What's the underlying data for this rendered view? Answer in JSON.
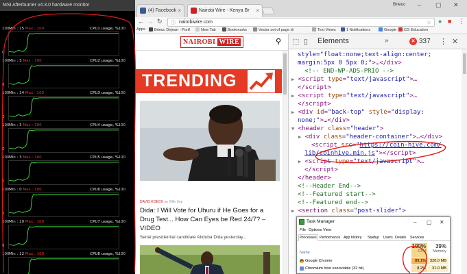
{
  "afterburner": {
    "title": "MSI Afterburner v4.3.0 hardware monitor",
    "top_scale": "100",
    "rows": [
      {
        "min": "15",
        "max": "100",
        "label": "CPU1 usage, %",
        "bottom": "0"
      },
      {
        "min": "3",
        "max": "100",
        "label": "CPU2 usage, %",
        "bottom": "0"
      },
      {
        "min": "14",
        "max": "100",
        "label": "CPU3 usage, %",
        "bottom": "0"
      },
      {
        "min": "3",
        "max": "100",
        "label": "CPU4 usage, %",
        "bottom": "0"
      },
      {
        "min": "3",
        "max": "100",
        "label": "CPU5 usage, %",
        "bottom": "0"
      },
      {
        "min": "0",
        "max": "100",
        "label": "CPU6 usage, %",
        "bottom": "0"
      },
      {
        "min": "10",
        "max": "100",
        "label": "CPU7 usage, %",
        "bottom": "0"
      },
      {
        "min": "12",
        "max": "100",
        "label": "CPU8 usage, %",
        "bottom": "0"
      }
    ],
    "min_label": "Min :",
    "max_label": "Max :"
  },
  "chrome": {
    "tabs": [
      {
        "title": "(4) Facebook"
      },
      {
        "title": "Nairobi Wire - Kenya Br"
      }
    ],
    "user": "Brieuc",
    "address": "nairobiwire.com",
    "bookmarks": [
      "Apps",
      "Brieuc Dejean - Portf",
      "New Tab",
      "Bookmarks",
      "Vector set of page di",
      "Text Views",
      "1 Notifications",
      "Google",
      "CG Education"
    ]
  },
  "site": {
    "logo_left": "NAIROBI",
    "logo_right": "WIRE",
    "trending": "TRENDING",
    "article1": {
      "author": "DAVID KOECH",
      "date_prefix": "on",
      "date": "24th Sep",
      "title": "Dida: I Will Vote for Uhuru if He Goes for a Drug Test... How Can Eyes be Red 24/7? – VIDEO",
      "excerpt": "Serial presidential candidate Abduba Dida yesterday..."
    }
  },
  "devtools": {
    "panel": "Elements",
    "error_count": "337",
    "lines": [
      {
        "indent": 0,
        "html": "<span class=\"av\">style=\"float:none;text-align:center;</span>"
      },
      {
        "indent": 0,
        "html": "<span class=\"av\">margin:5px 0 5px 0;\"</span><span class=\"tg\">&gt;…&lt;/div&gt;</span>"
      },
      {
        "indent": 1,
        "html": "<span class=\"cm\">&lt;!-- END-WP-ADS-PRIO --&gt;</span>"
      },
      {
        "indent": 0,
        "tri": "▶",
        "html": "<span class=\"tg\">&lt;script </span><span class=\"an\">type</span><span class=\"tg\">=</span><span class=\"av\">\"text/javascript\"</span><span class=\"tg\">&gt;…</span>"
      },
      {
        "indent": 0,
        "html": "<span class=\"tg\">&lt;/script&gt;</span>"
      },
      {
        "indent": 0,
        "tri": "▶",
        "html": "<span class=\"tg\">&lt;script </span><span class=\"an\">type</span><span class=\"tg\">=</span><span class=\"av\">\"text/javascript\"</span><span class=\"tg\">&gt;…</span>"
      },
      {
        "indent": 0,
        "html": "<span class=\"tg\">&lt;/script&gt;</span>"
      },
      {
        "indent": 0,
        "tri": "▶",
        "html": "<span class=\"tg\">&lt;div </span><span class=\"an\">id</span><span class=\"tg\">=</span><span class=\"av\">\"back-top\"</span><span class=\"tg\"> </span><span class=\"an\">style</span><span class=\"tg\">=</span><span class=\"av\">\"display:</span>"
      },
      {
        "indent": 0,
        "html": "<span class=\"av\">none;\"</span><span class=\"tg\">&gt;…&lt;/div&gt;</span>"
      },
      {
        "indent": 0,
        "tri": "▼",
        "html": "<span class=\"tg\">&lt;header </span><span class=\"an\">class</span><span class=\"tg\">=</span><span class=\"av\">\"header\"</span><span class=\"tg\">&gt;</span>"
      },
      {
        "indent": 1,
        "tri": "▶",
        "html": "<span class=\"tg\">&lt;div </span><span class=\"an\">class</span><span class=\"tg\">=</span><span class=\"av\">\"header-container\"</span><span class=\"tg\">&gt;…&lt;/div&gt;</span>"
      },
      {
        "indent": 2,
        "html": "<span class=\"tg\">&lt;script </span><span class=\"an\">src</span><span class=\"tg\">=</span><span class=\"av\">\"<a>https://coin-hive.com/</a></span>"
      },
      {
        "indent": 1,
        "html": "<span class=\"av\"><a>lib/coinhive.min.js</a>\"</span><span class=\"tg\">&gt;&lt;/script&gt;</span>"
      },
      {
        "indent": 1,
        "tri": "▶",
        "html": "<span class=\"tg\">&lt;script </span><span class=\"an\">type</span><span class=\"tg\">=</span><span class=\"av\">\"text/javascript\"</span><span class=\"tg\">&gt;…</span>"
      },
      {
        "indent": 1,
        "html": "<span class=\"tg\">&lt;/script&gt;</span>"
      },
      {
        "indent": 0,
        "html": "<span class=\"tg\">&lt;/header&gt;</span>"
      },
      {
        "indent": 0,
        "html": "<span class=\"cm\">&lt;!--Header End--&gt;</span>"
      },
      {
        "indent": 0,
        "html": "<span class=\"cm\">&lt;!--Featured start--&gt;</span>"
      },
      {
        "indent": 0,
        "html": "<span class=\"cm\">&lt;!--Featured end--&gt;</span>"
      },
      {
        "indent": 0,
        "tri": "▶",
        "html": "<span class=\"tg\">&lt;section </span><span class=\"an\">class</span><span class=\"tg\">=</span><span class=\"av\">\"post-slider\"</span><span class=\"tg\">&gt;</span>"
      }
    ]
  },
  "taskmanager": {
    "title": "Task Manager",
    "menu": [
      "File",
      "Options",
      "View"
    ],
    "tabs": [
      "Processes",
      "Performance",
      "App history",
      "Startup",
      "Users",
      "Details",
      "Services"
    ],
    "col_name": "Name",
    "cpu_pct": "100%",
    "cpu_label": "CPU",
    "mem_pct": "39%",
    "mem_label": "Memory",
    "rows": [
      {
        "name": "Google Chrome",
        "cpu": "89.1%",
        "mem": "320.0 MB"
      },
      {
        "name": "Chromium host executable (32 bit)",
        "cpu": "8.2%",
        "mem": "31.0 MB"
      }
    ]
  },
  "colors": {
    "accent_red": "#e53a24",
    "annotation_red": "#e11b1b",
    "graph_green": "#3dd63d"
  }
}
